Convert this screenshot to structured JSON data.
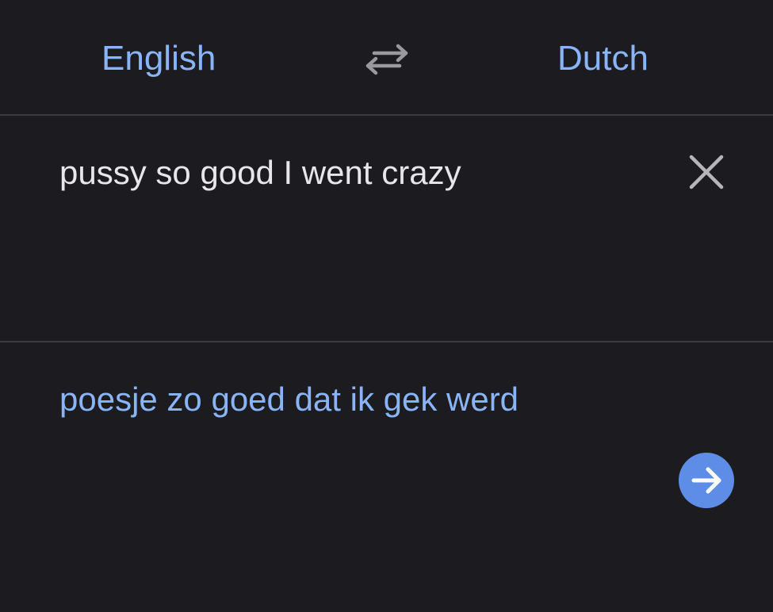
{
  "languages": {
    "source_label": "English",
    "target_label": "Dutch",
    "swap_icon": "swap-arrows-icon"
  },
  "input": {
    "text": "pussy so good I went crazy",
    "clear_icon": "close-icon"
  },
  "output": {
    "text": "poesje zo goed dat ik gek werd",
    "go_icon": "arrow-right-icon"
  },
  "colors": {
    "background": "#1c1b1f",
    "accent": "#8ab4f8",
    "button": "#5e8de8",
    "text": "#e8e6ea",
    "divider": "#3c3b40"
  }
}
